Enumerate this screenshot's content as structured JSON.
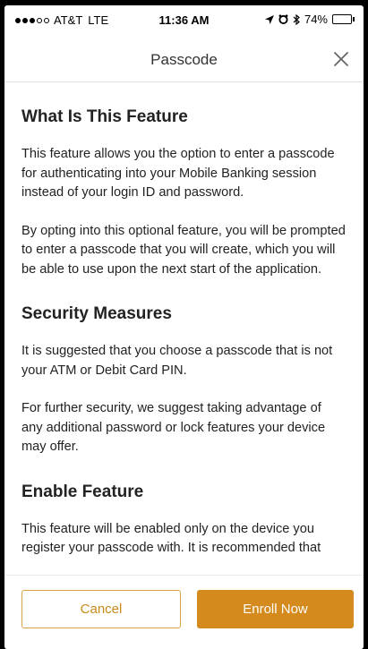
{
  "status_bar": {
    "carrier": "AT&T",
    "network": "LTE",
    "time": "11:36 AM",
    "battery_percent": "74%",
    "battery_level": 0.74,
    "icons": [
      "location-arrow-icon",
      "alarm-icon",
      "bluetooth-icon",
      "battery-icon"
    ]
  },
  "header": {
    "title": "Passcode",
    "close_icon": "close-icon"
  },
  "sections": [
    {
      "heading": "What Is This Feature",
      "paragraphs": [
        "This feature allows you the option to enter a passcode for authenticating into your Mobile Banking session instead of your login ID and password.",
        "By opting into this optional feature, you will be prompted to enter a passcode that you will create, which you will be able to use upon the next start of the application."
      ]
    },
    {
      "heading": "Security Measures",
      "paragraphs": [
        "It is suggested that you choose a passcode that is not your ATM or Debit Card PIN.",
        "For further security, we suggest taking advantage of any additional password or lock features your device may offer."
      ]
    },
    {
      "heading": "Enable Feature",
      "paragraphs": [
        "This feature will be enabled only on the device you register your passcode with. It is recommended that"
      ]
    }
  ],
  "footer": {
    "cancel_label": "Cancel",
    "enroll_label": "Enroll Now"
  },
  "colors": {
    "accent": "#d48a1c",
    "accent_text": "#c98a1a",
    "text": "#222222"
  }
}
